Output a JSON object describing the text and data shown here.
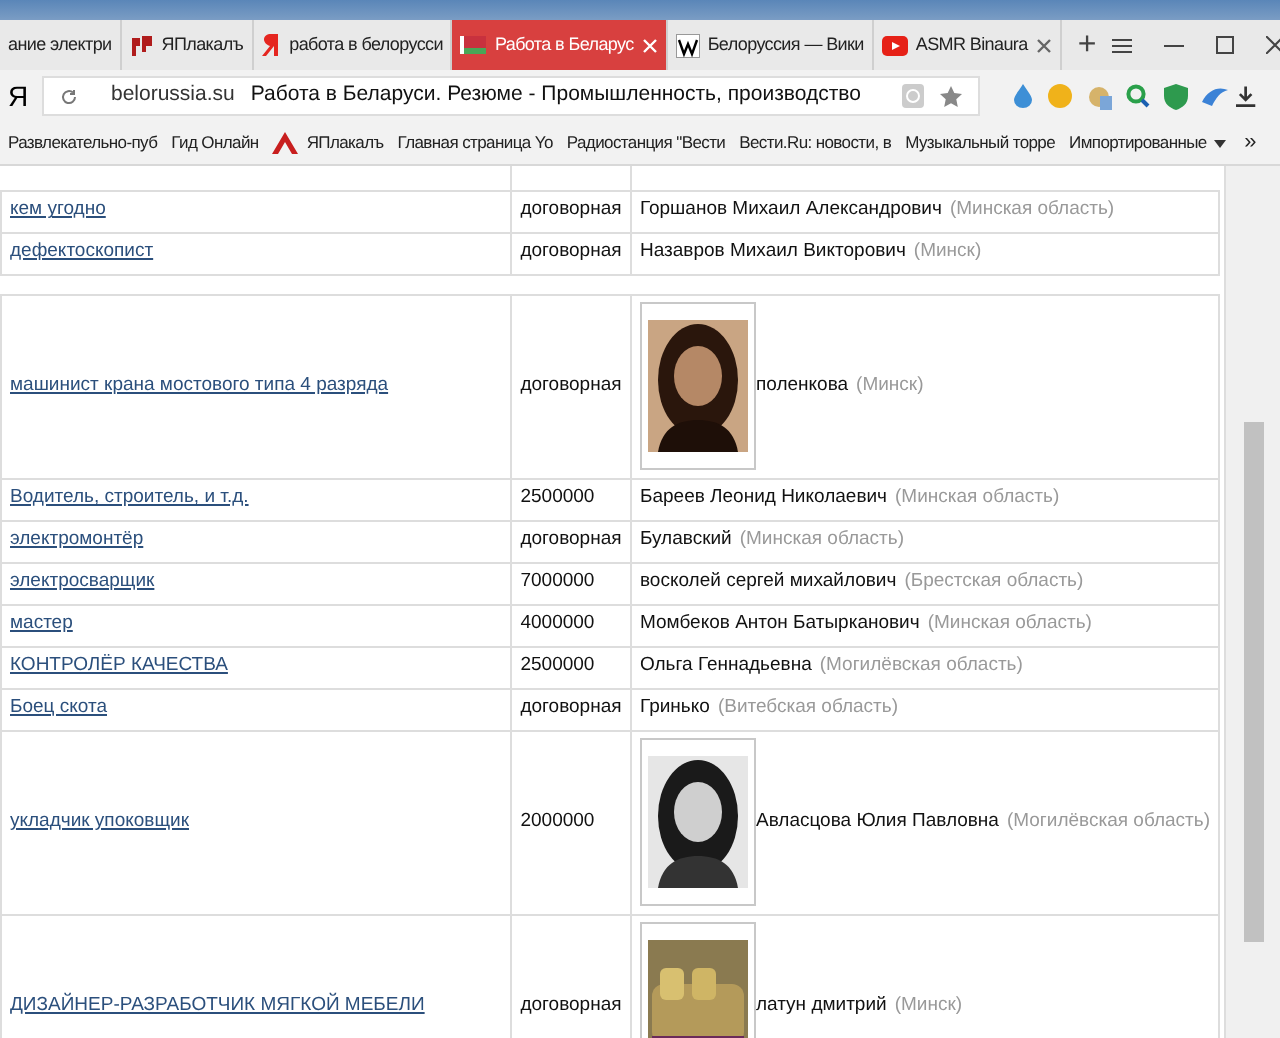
{
  "tabs": [
    {
      "label": "ание электри",
      "kind": "plain",
      "selected": false,
      "closable": false
    },
    {
      "label": "ЯПлакалъ",
      "kind": "yaplakal",
      "selected": false,
      "closable": false
    },
    {
      "label": "работа в белорусси",
      "kind": "yandex",
      "selected": false,
      "closable": false
    },
    {
      "label": "Работа в Беларус",
      "kind": "flag",
      "selected": true,
      "closable": true
    },
    {
      "label": "Белоруссия — Вики",
      "kind": "wiki",
      "selected": false,
      "closable": false
    },
    {
      "label": "ASMR Binaura",
      "kind": "video",
      "selected": false,
      "closable": true
    }
  ],
  "new_tab": "+",
  "address_bar": {
    "logo": "Я",
    "domain": "belorussia.su",
    "title": "Работа в Беларуси. Резюме - Промышленность, производство"
  },
  "bookmarks": [
    {
      "label": "Развлекательно-пуб",
      "kind": "plain"
    },
    {
      "label": "Гид Онлайн",
      "kind": "plain"
    },
    {
      "label": "ЯПлакалъ",
      "kind": "yaplakal"
    },
    {
      "label": "Главная страница Yo",
      "kind": "plain"
    },
    {
      "label": "Радиостанция \"Вести",
      "kind": "plain"
    },
    {
      "label": "Вести.Ru: новости, в",
      "kind": "plain"
    },
    {
      "label": "Музыкальный торре",
      "kind": "plain"
    },
    {
      "label": "Импортированные",
      "kind": "folder"
    }
  ],
  "bookmarks_more": "»",
  "rows": [
    {
      "kind": "partial"
    },
    {
      "kind": "text",
      "job": "кем угодно",
      "salary": "договорная",
      "name": "Горшанов Михаил Александрович",
      "region": "(Минская область)"
    },
    {
      "kind": "text",
      "job": "дефектоскопист",
      "salary": "договорная",
      "name": "Назавров Михаил Викторович",
      "region": "(Минск)"
    },
    {
      "kind": "spacer"
    },
    {
      "job": "машинист крана мостового типа 4 разряда",
      "salary": "договорная",
      "name": "поленкова",
      "region": "(Минск)"
    },
    {
      "kind": "text",
      "job": "Водитель, строитель, и т.д.",
      "salary": "2500000",
      "name": "Бареев Леонид Николаевич",
      "region": "(Минская область)"
    },
    {
      "kind": "text",
      "job": "электромонтёр",
      "salary": "договорная",
      "name": "Булавский",
      "region": "(Минская область)"
    },
    {
      "kind": "text",
      "job": "электросварщик",
      "salary": "7000000",
      "name": "восколей сергей михайлович",
      "region": "(Брестская область)"
    },
    {
      "kind": "text",
      "job": "мастер",
      "salary": "4000000",
      "name": "Момбеков Антон Батырканович",
      "region": "(Минская область)"
    },
    {
      "kind": "text",
      "job": "КОНТРОЛЁР КАЧЕСТВА",
      "salary": "2500000",
      "name": "Ольга Геннадьевна",
      "region": "(Могилёвская область)"
    },
    {
      "kind": "text",
      "job": "Боец скота",
      "salary": "договорная",
      "name": "Гринько",
      "region": "(Витебская область)"
    },
    {
      "job": "укладчик упоковщик",
      "salary": "2000000",
      "name": "Авласцова Юлия Павловна",
      "region": "(Могилёвская область)"
    },
    {
      "job": "ДИЗАЙНЕР-РАЗРАБОТЧИК МЯГКОЙ МЕБЕЛИ",
      "salary": "договорная",
      "name": "латун дмитрий",
      "region": "(Минск)"
    }
  ]
}
